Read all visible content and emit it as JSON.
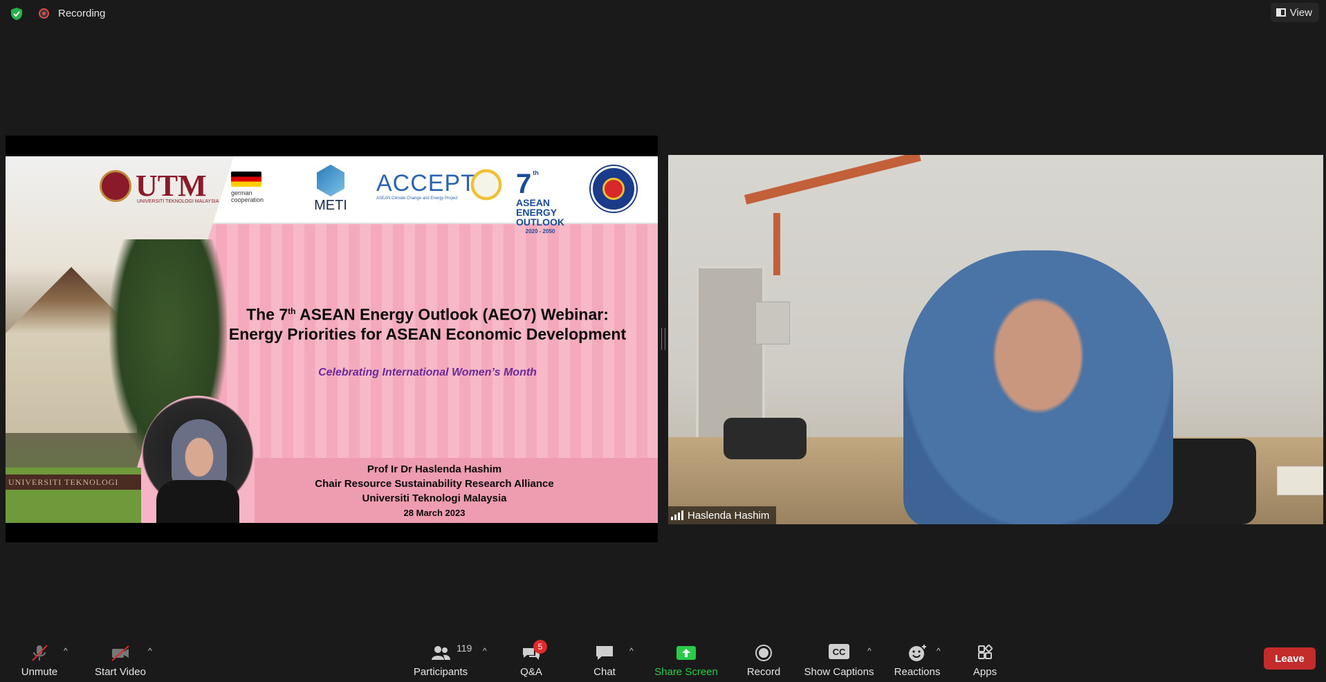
{
  "topbar": {
    "recording_label": "Recording",
    "view_label": "View"
  },
  "slide": {
    "logos": {
      "utm": "UTM",
      "utm_sub": "UNIVERSITI TEKNOLOGI MALAYSIA",
      "giz_line1": "german",
      "giz_line2": "cooperation",
      "meti": "METI",
      "accept": "ACCEPT",
      "accept_sub": "ASEAN Climate Change and Energy Project",
      "aeo_num": "7",
      "aeo_th": "th",
      "aeo_line1": "ASEAN",
      "aeo_line2": "ENERGY",
      "aeo_line3": "OUTLOOK",
      "aeo_years": "2020 - 2050"
    },
    "title_line1_a": "The 7",
    "title_line1_sup": "th",
    "title_line1_b": " ASEAN Energy Outlook (AEO7) Webinar:",
    "title_line2": "Energy Priorities for ASEAN Economic Development",
    "subtitle": "Celebrating International Women’s Month",
    "presenter": "Prof Ir Dr Haslenda Hashim",
    "role": "Chair Resource Sustainability Research Alliance",
    "institution": "Universiti Teknologi Malaysia",
    "date": "28 March 2023",
    "sign_text": "UNIVERSITI TEKNOLOGI"
  },
  "video": {
    "participant_name": "Haslenda Hashim"
  },
  "toolbar": {
    "unmute": "Unmute",
    "start_video": "Start Video",
    "participants": "Participants",
    "participants_count": "119",
    "qa": "Q&A",
    "qa_badge": "5",
    "chat": "Chat",
    "share_screen": "Share Screen",
    "record": "Record",
    "show_captions": "Show Captions",
    "cc": "CC",
    "reactions": "Reactions",
    "apps": "Apps",
    "leave": "Leave"
  },
  "colors": {
    "background": "#1a1a1a",
    "share_green": "#2bcb4a",
    "leave_red": "#c42b2b",
    "slide_pink": "#f7b4c6"
  }
}
